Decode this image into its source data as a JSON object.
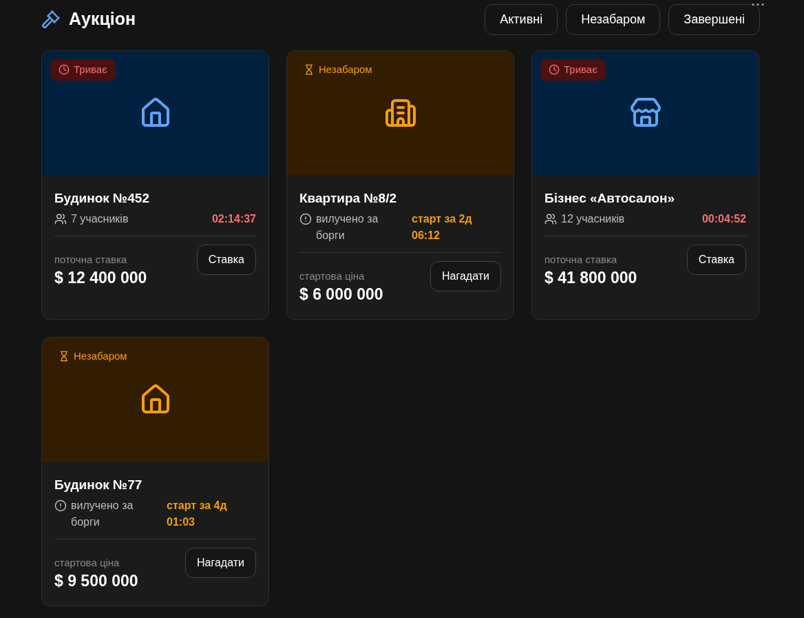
{
  "header": {
    "title": "Аукціон"
  },
  "filters": [
    {
      "label": "Активні"
    },
    {
      "label": "Незабаром"
    },
    {
      "label": "Завершені"
    }
  ],
  "lots": [
    {
      "kind": "live",
      "badge": "Триває",
      "title": "Будинок №452",
      "info": "7 учасників",
      "timer": "02:14:37",
      "price_label": "поточна ставка",
      "price": "$ 12 400 000",
      "action": "Ставка"
    },
    {
      "kind": "soon",
      "badge": "Незабаром",
      "title": "Квартира №8/2",
      "info": "вилучено за борги",
      "timer": "старт за 2д 06:12",
      "price_label": "стартова ціна",
      "price": "$ 6 000 000",
      "action": "Нагадати"
    },
    {
      "kind": "live",
      "badge": "Триває",
      "title": "Бізнес «Автосалон»",
      "info": "12 учасників",
      "timer": "00:04:52",
      "price_label": "поточна ставка",
      "price": "$ 41 800 000",
      "action": "Ставка"
    },
    {
      "kind": "soon",
      "badge": "Незабаром",
      "title": "Будинок №77",
      "info": "вилучено за борги",
      "timer": "старт за 4д 01:03",
      "price_label": "стартова ціна",
      "price": "$ 9 500 000",
      "action": "Нагадати"
    }
  ]
}
